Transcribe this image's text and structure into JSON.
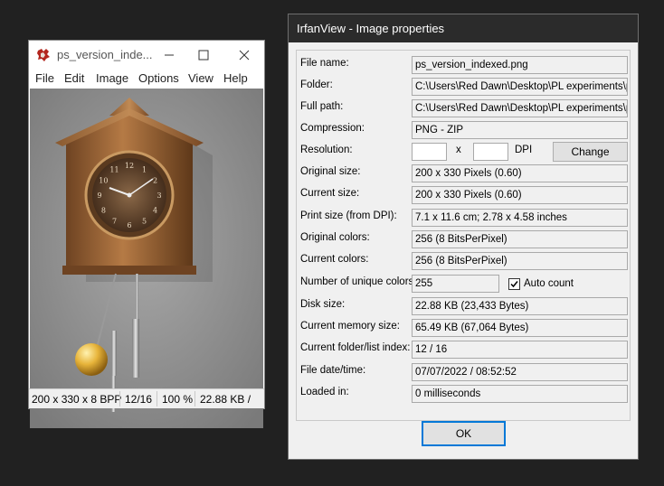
{
  "viewer": {
    "title": "ps_version_inde...",
    "menu": [
      "File",
      "Edit",
      "Image",
      "Options",
      "View",
      "Help"
    ],
    "clock_numerals": [
      "12",
      "1",
      "2",
      "3",
      "4",
      "5",
      "6",
      "7",
      "8",
      "9",
      "10",
      "11"
    ],
    "status": {
      "dimensions": "200 x 330 x 8 BPP",
      "index": "12/16",
      "zoom": "100 %",
      "filesize": "22.88 KB / "
    }
  },
  "dialog": {
    "title": "IrfanView - Image properties",
    "labels": {
      "file_name": "File name:",
      "folder": "Folder:",
      "full_path": "Full path:",
      "compression": "Compression:",
      "resolution": "Resolution:",
      "original_size": "Original size:",
      "current_size": "Current size:",
      "print_size": "Print size (from DPI):",
      "original_colors": "Original colors:",
      "current_colors": "Current colors:",
      "unique_colors": "Number of unique colors:",
      "disk_size": "Disk size:",
      "memory_size": "Current memory size:",
      "folder_index": "Current folder/list index:",
      "file_date": "File date/time:",
      "loaded_in": "Loaded in:"
    },
    "values": {
      "file_name": "ps_version_indexed.png",
      "folder": "C:\\Users\\Red Dawn\\Desktop\\PL experiments\\pr",
      "full_path": "C:\\Users\\Red Dawn\\Desktop\\PL experiments\\pr",
      "compression": "PNG - ZIP",
      "resolution_x": "",
      "resolution_y": "",
      "original_size": "200 x 330  Pixels (0.60)",
      "current_size": "200 x 330  Pixels (0.60)",
      "print_size": "7.1 x 11.6 cm; 2.78 x 4.58 inches",
      "original_colors": "256   (8 BitsPerPixel)",
      "current_colors": "256   (8 BitsPerPixel)",
      "unique_colors": "255",
      "disk_size": "22.88 KB (23,433 Bytes)",
      "memory_size": "65.49  KB (67,064 Bytes)",
      "folder_index": "12  /  16",
      "file_date": "07/07/2022 / 08:52:52",
      "loaded_in": "0 milliseconds"
    },
    "x_text": "x",
    "dpi_text": "DPI",
    "change_button": "Change",
    "auto_count_label": "Auto count",
    "auto_count_checked": true,
    "ok_button": "OK"
  }
}
